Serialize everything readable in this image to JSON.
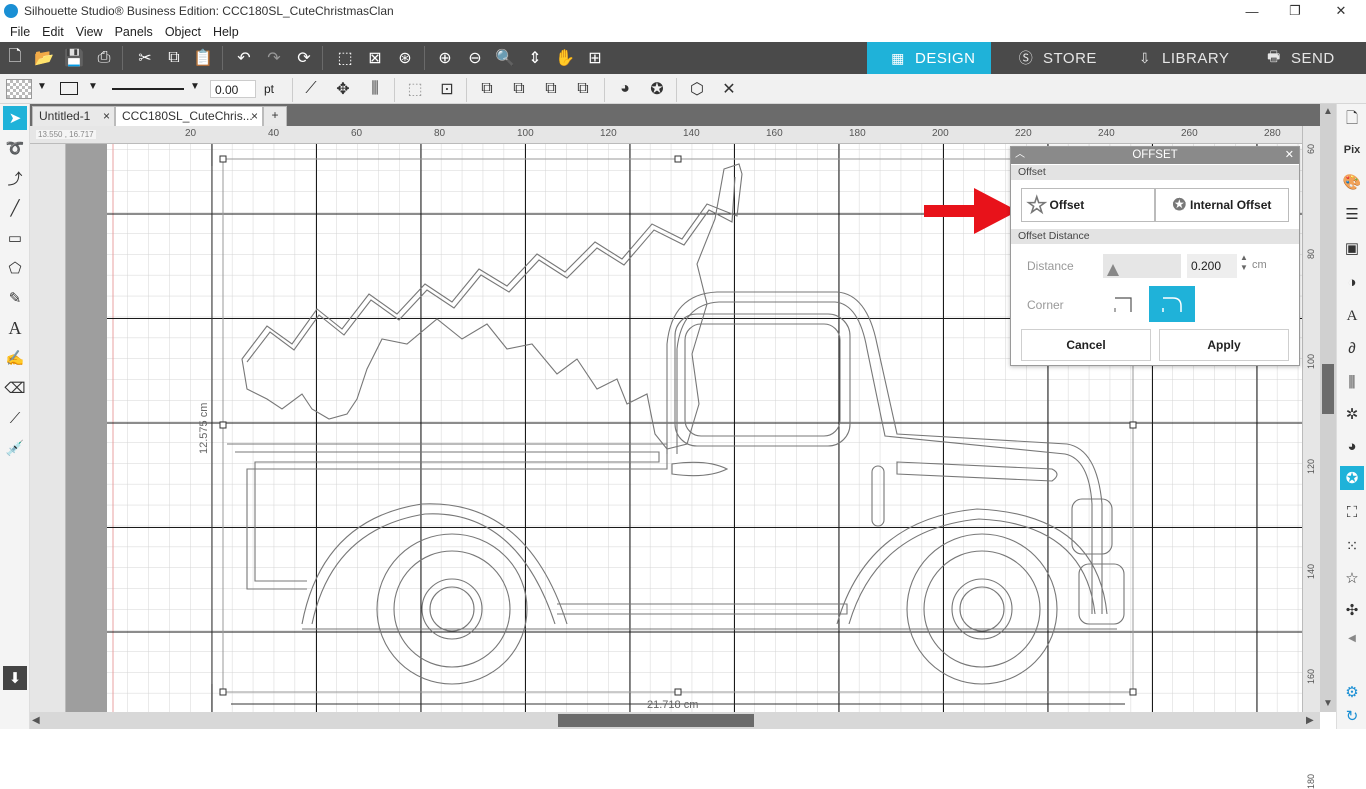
{
  "window": {
    "title": "Silhouette Studio® Business Edition: CCC180SL_CuteChristmasClan",
    "minimize": "—",
    "restore": "❐",
    "close": "✕"
  },
  "menu": [
    "File",
    "Edit",
    "View",
    "Panels",
    "Object",
    "Help"
  ],
  "top_tabs": {
    "design": "DESIGN",
    "store": "STORE",
    "library": "LIBRARY",
    "send": "SEND"
  },
  "line_style": {
    "width_value": "0.00",
    "unit": "pt"
  },
  "doc_tabs": [
    {
      "label": "Untitled-1",
      "close": "×"
    },
    {
      "label": "CCC180SL_CuteChris...",
      "close": "×"
    },
    {
      "label": "+"
    }
  ],
  "coords": "13.550 , 16.717",
  "ruler_top": [
    "20",
    "40",
    "60",
    "80",
    "100",
    "120",
    "140",
    "160",
    "180",
    "200",
    "220",
    "240",
    "260",
    "280"
  ],
  "ruler_right": [
    "60",
    "80",
    "100",
    "120",
    "140",
    "160",
    "180"
  ],
  "dimensions": {
    "width": "21.718 cm",
    "height": "12.575 cm"
  },
  "offset_panel": {
    "title": "OFFSET",
    "section_offset": "Offset",
    "offset_button": "Offset",
    "internal_offset_button": "Internal Offset",
    "section_distance": "Offset Distance",
    "distance_label": "Distance",
    "distance_value": "0.200",
    "distance_unit": "cm",
    "corner_label": "Corner",
    "cancel": "Cancel",
    "apply": "Apply"
  },
  "colors": {
    "accent": "#1fb2d9",
    "arrow": "#e8121a",
    "toolbar_dark": "#4a4a4a"
  }
}
